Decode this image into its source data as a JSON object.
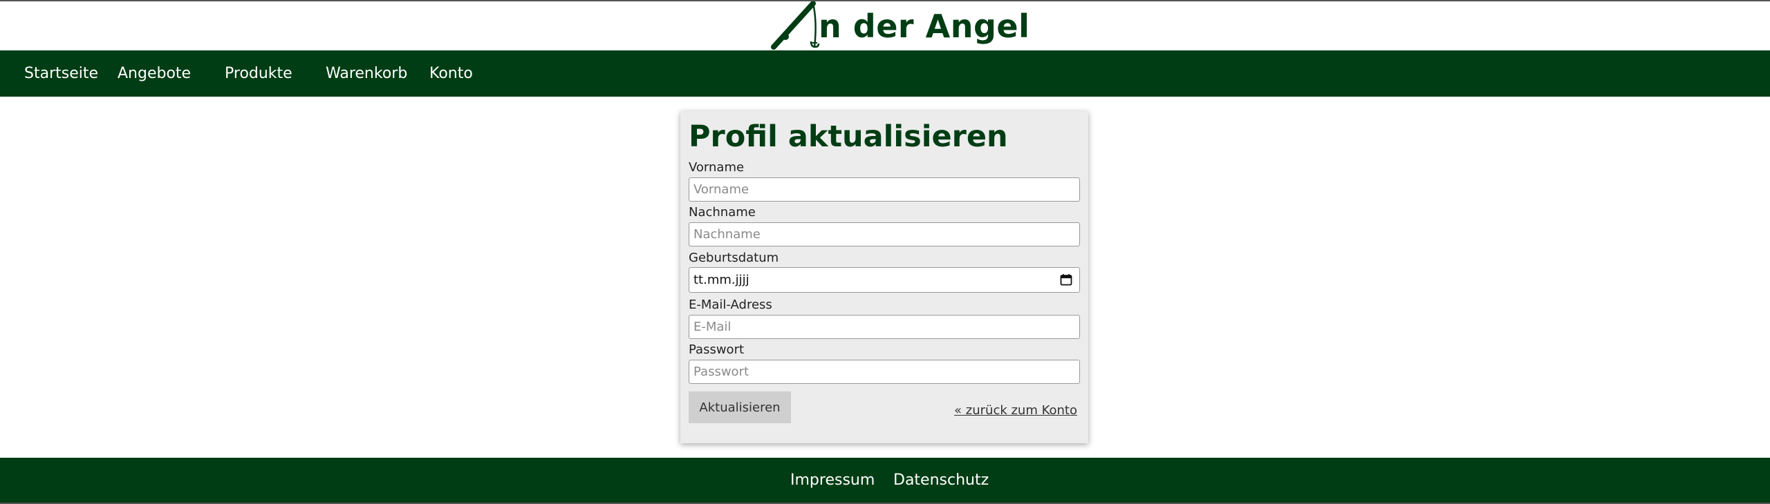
{
  "brand": {
    "logo_text": "n der Angel",
    "color": "#003d14"
  },
  "nav": {
    "items": [
      {
        "label": "Startseite"
      },
      {
        "label": "Angebote"
      },
      {
        "label": "Produkte"
      },
      {
        "label": "Warenkorb"
      },
      {
        "label": "Konto"
      }
    ]
  },
  "form": {
    "title": "Profil aktualisieren",
    "fields": {
      "vorname": {
        "label": "Vorname",
        "placeholder": "Vorname",
        "value": ""
      },
      "nachname": {
        "label": "Nachname",
        "placeholder": "Nachname",
        "value": ""
      },
      "geburtsdatum": {
        "label": "Geburtsdatum",
        "display": "tt.mm.jjjj"
      },
      "email": {
        "label": "E-Mail-Adress",
        "placeholder": "E-Mail",
        "value": ""
      },
      "passwort": {
        "label": "Passwort",
        "placeholder": "Passwort",
        "value": ""
      }
    },
    "submit_label": "Aktualisieren",
    "back_link": "« zurück zum Konto"
  },
  "footer": {
    "links": [
      {
        "label": "Impressum"
      },
      {
        "label": "Datenschutz"
      }
    ]
  },
  "colors": {
    "primary": "#003d14",
    "card_bg": "#ececec",
    "button_bg": "#cfcfcf"
  }
}
